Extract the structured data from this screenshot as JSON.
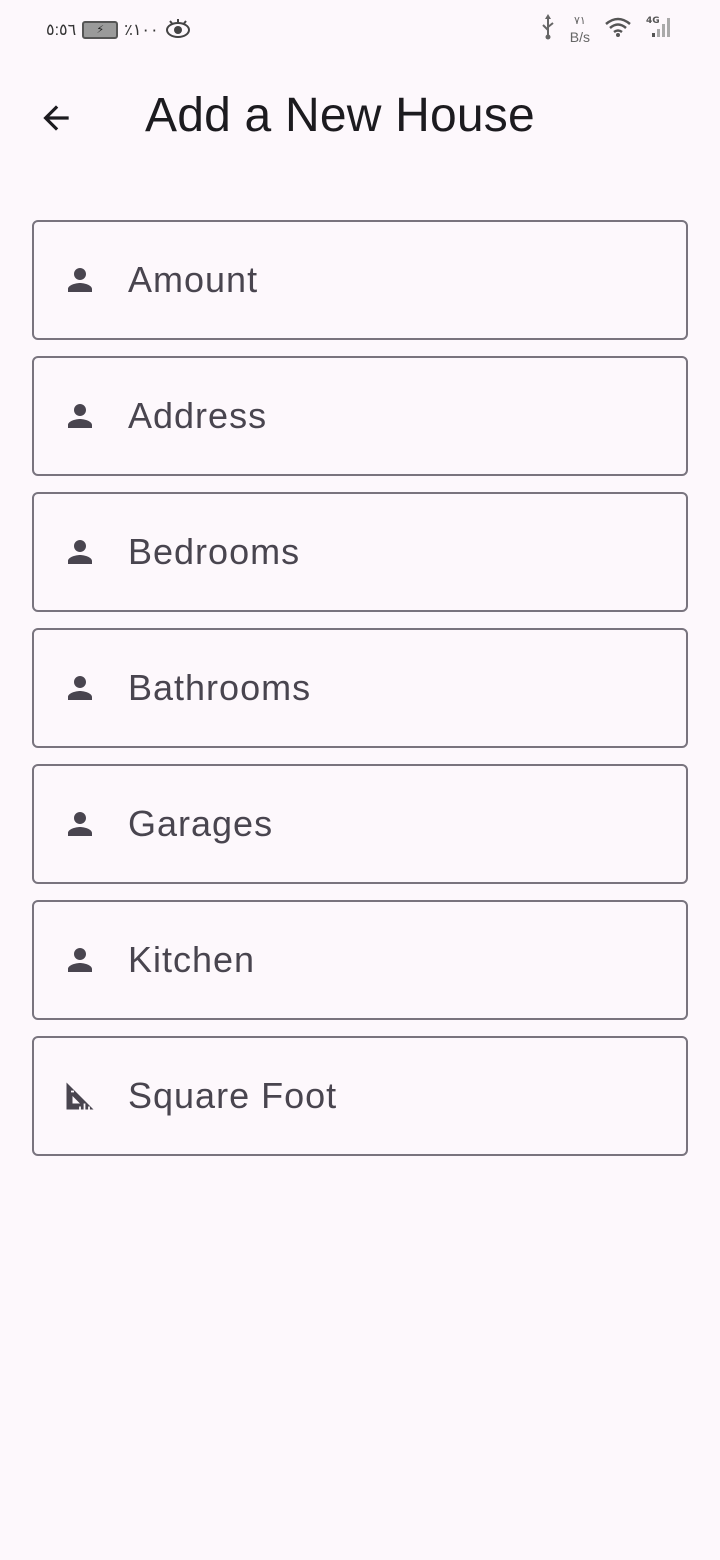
{
  "status_bar": {
    "time": "٥:٥٦",
    "battery_text": "٪١٠٠",
    "net_speed_value": "٧١",
    "net_speed_unit": "B/s",
    "network_type": "4G"
  },
  "app_bar": {
    "title": "Add a New House",
    "back_icon": "arrow-back-icon"
  },
  "fields": [
    {
      "placeholder": "Amount",
      "icon": "person-icon"
    },
    {
      "placeholder": "Address",
      "icon": "person-icon"
    },
    {
      "placeholder": "Bedrooms",
      "icon": "person-icon"
    },
    {
      "placeholder": "Bathrooms",
      "icon": "person-icon"
    },
    {
      "placeholder": "Garages",
      "icon": "person-icon"
    },
    {
      "placeholder": "Kitchen",
      "icon": "person-icon"
    },
    {
      "placeholder": "Square Foot",
      "icon": "square-foot-icon"
    }
  ],
  "colors": {
    "background": "#fdf8fc",
    "border": "#79747e",
    "icon": "#49454f",
    "text": "#1c1b1f"
  }
}
